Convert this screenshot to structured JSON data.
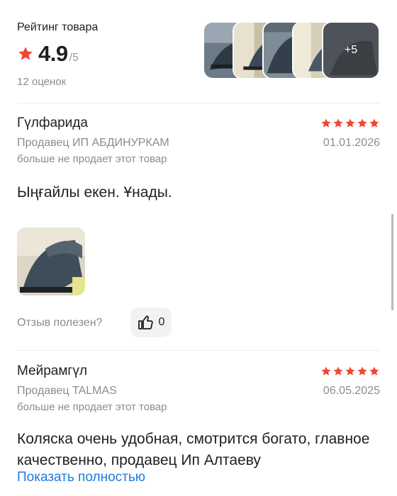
{
  "rating": {
    "title": "Рейтинг товара",
    "value": "4.9",
    "max": "/5",
    "count": "12 оценок",
    "star_color": "#f14635"
  },
  "photos": {
    "more_label": "+5",
    "count_thumbs": 5
  },
  "reviews": [
    {
      "name": "Гүлфарида",
      "stars": 5,
      "seller": "Продавец ИП АБДИНУРКАМ",
      "date": "01.01.2026",
      "seller_note": "больше не продает этот товар",
      "text": "Ыңғайлы екен. Ұнады.",
      "has_photo": true,
      "helpful_label": "Отзыв полезен?",
      "likes": "0"
    },
    {
      "name": "Мейрамгүл",
      "stars": 5,
      "seller": "Продавец TALMAS",
      "date": "06.05.2025",
      "seller_note": "больше не продает этот товар",
      "text": "Коляска очень удобная, смотрится богато, главное качественно, продавец Ип Алтаеву",
      "show_more": "Показать полностью"
    }
  ],
  "colors": {
    "accent_star": "#f14635",
    "link": "#1f7ae0",
    "muted_text": "#8c8c8c"
  }
}
